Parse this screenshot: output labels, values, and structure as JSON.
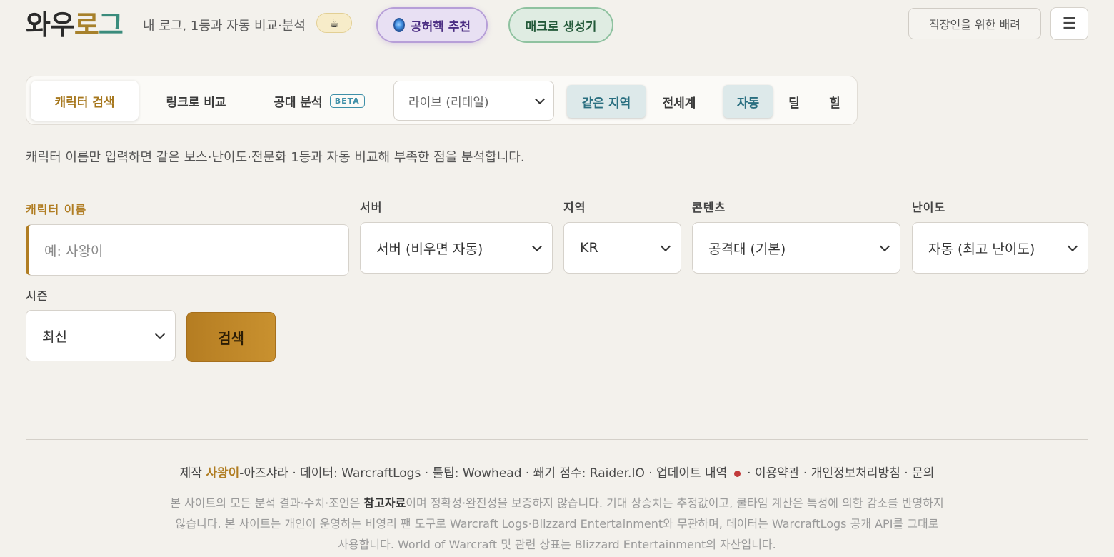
{
  "header": {
    "logo": {
      "p1": "와우",
      "p2": "로",
      "p3": "그"
    },
    "tagline": "내 로그, 1등과 자동 비교·분석",
    "coffee_icon": "coffee-cup-icon",
    "recommend_button": "공허핵 추천",
    "macro_button": "매크로 생성기",
    "worker_button": "직장인을 위한 배려",
    "menu_icon": "☰"
  },
  "tabs": {
    "character_search": "캐릭터 검색",
    "link_compare": "링크로 비교",
    "raid_analysis": "공대 분석",
    "beta": "BETA",
    "realm_select": "라이브 (리테일)",
    "same_region": "같은 지역",
    "world": "전세계",
    "auto": "자동",
    "deal": "딜",
    "heal": "힐"
  },
  "description": "캐릭터 이름만 입력하면 같은 보스·난이도·전문화 1등과 자동 비교해 부족한 점을 분석합니다.",
  "form": {
    "name_label": "캐릭터 이름",
    "name_placeholder": "예: 사왕이",
    "server_label": "서버",
    "server_value": "서버 (비우면 자동)",
    "region_label": "지역",
    "region_value": "KR",
    "content_label": "콘텐츠",
    "content_value": "공격대 (기본)",
    "difficulty_label": "난이도",
    "difficulty_value": "자동 (최고 난이도)",
    "season_label": "시즌",
    "season_value": "최신",
    "search_button": "검색"
  },
  "footer": {
    "made_by": "제작",
    "author": "사왕이",
    "credits_rest": "-아즈샤라 · 데이터: WarcraftLogs · 툴팁: Wowhead · 쐐기 점수: Raider.IO · ",
    "update_log": "업데이트 내역",
    "sep1": " · ",
    "terms": "이용약관",
    "sep2": " · ",
    "privacy": "개인정보처리방침",
    "sep3": " · ",
    "contact": "문의",
    "disclaimer_pre": "본 사이트의 모든 분석 결과·수치·조언은 ",
    "disclaimer_bold": "참고자료",
    "disclaimer_post": "이며 정확성·완전성을 보증하지 않습니다. 기대 상승치는 추정값이고, 쿨타임 계산은 특성에 의한 감소를 반영하지 않습니다. 본 사이트는 개인이 운영하는 비영리 팬 도구로 Warcraft Logs·Blizzard Entertainment와 무관하며, 데이터는 WarcraftLogs 공개 API를 그대로 사용합니다. World of Warcraft 및 관련 상표는 Blizzard Entertainment의 자산입니다."
  }
}
